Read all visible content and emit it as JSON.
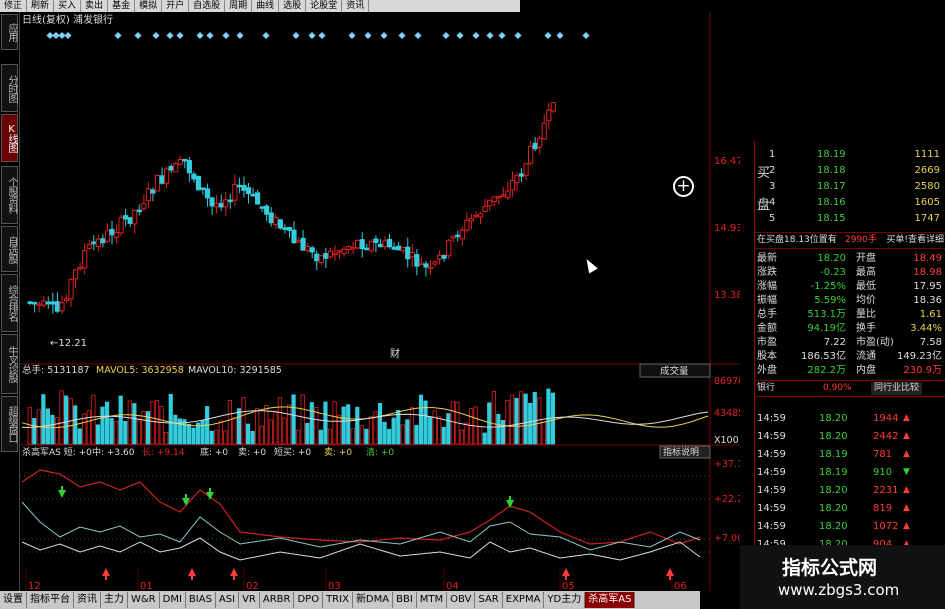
{
  "toolbar": [
    "修正",
    "刷新",
    "买入",
    "卖出",
    "基金",
    "模拟",
    "开户",
    "自选股",
    "周期",
    "曲线",
    "选股",
    "论股堂",
    "资讯"
  ],
  "left_tabs": [
    "应用",
    "分时图",
    "K线图",
    "个股资料",
    "自选股",
    "综合排名",
    "牛叉诊股",
    "超级盘口"
  ],
  "title": "日线(复权) 浦发银行",
  "price_axis": [
    "16.47",
    "14.93",
    "13.38"
  ],
  "low_label": "12.21",
  "marker_label": "财",
  "volume_header": {
    "total": "总手: 5131187",
    "mavol5": "MAVOL5: 3632958",
    "mavol10": "MAVOL10: 3291585",
    "dropdown": "成交量"
  },
  "volume_axis": [
    "86970",
    "43485",
    "X100"
  ],
  "indicator_header": {
    "name": "杀高军AS 短: +0",
    "mid": "中: +3.60",
    "long": "长: +9.14",
    "bottom": "底: +0",
    "sell": "卖: +0",
    "short2": "短买: +0",
    "sell2": "卖: +0",
    "clear": "清: +0",
    "help": "指标说明"
  },
  "indicator_axis": [
    "+37.16",
    "+22.27",
    "+7.00"
  ],
  "time_axis": [
    "12",
    "01",
    "02",
    "03",
    "04",
    "05",
    "06"
  ],
  "bottom_tabs": [
    "设置",
    "指标平台",
    "资讯",
    "主力",
    "W&R",
    "DMI",
    "BIAS",
    "ASI",
    "VR",
    "ARBR",
    "DPO",
    "TRIX",
    "新DMA",
    "BBI",
    "MTM",
    "OBV",
    "SAR",
    "EXPMA",
    "YD主力",
    "杀高军AS"
  ],
  "order_book": [
    {
      "side": "买",
      "level": "1",
      "price": "18.19",
      "vol": "1111"
    },
    {
      "side": "",
      "level": "2",
      "price": "18.18",
      "vol": "2669"
    },
    {
      "side": "",
      "level": "3",
      "price": "18.17",
      "vol": "2580"
    },
    {
      "side": "盘",
      "level": "4",
      "price": "18.16",
      "vol": "1605"
    },
    {
      "side": "",
      "level": "5",
      "price": "18.15",
      "vol": "1747"
    }
  ],
  "order_note": "在买盘18.13位置有",
  "order_note_vol": "2990手",
  "order_note_btn": "买单!查看详细",
  "quote_stats": [
    [
      "最新",
      "18.20",
      "开盘",
      "18.49"
    ],
    [
      "涨跌",
      "-0.23",
      "最高",
      "18.98"
    ],
    [
      "涨幅",
      "-1.25%",
      "最低",
      "17.95"
    ],
    [
      "振幅",
      "5.59%",
      "均价",
      "18.36"
    ],
    [
      "总手",
      "513.1万",
      "量比",
      "1.61"
    ],
    [
      "金额",
      "94.19亿",
      "换手",
      "3.44%"
    ],
    [
      "市盈",
      "7.22",
      "市盈(动)",
      "7.58"
    ],
    [
      "股本",
      "186.53亿",
      "流通",
      "149.23亿"
    ],
    [
      "外盘",
      "282.2万",
      "内盘",
      "230.9万"
    ]
  ],
  "sector": {
    "name": "银行",
    "change": "0.90%",
    "btn": "同行业比较"
  },
  "trades": [
    {
      "time": "14:59",
      "price": "18.20",
      "vol": "1944",
      "dir": "up"
    },
    {
      "time": "14:59",
      "price": "18.20",
      "vol": "2442",
      "dir": "up"
    },
    {
      "time": "14:59",
      "price": "18.19",
      "vol": "781",
      "dir": "up"
    },
    {
      "time": "14:59",
      "price": "18.19",
      "vol": "910",
      "dir": "down"
    },
    {
      "time": "14:59",
      "price": "18.20",
      "vol": "2231",
      "dir": "up"
    },
    {
      "time": "14:59",
      "price": "18.20",
      "vol": "819",
      "dir": "up"
    },
    {
      "time": "14:59",
      "price": "18.20",
      "vol": "1072",
      "dir": "up"
    },
    {
      "time": "14:59",
      "price": "18.20",
      "vol": "904",
      "dir": "up"
    }
  ],
  "watermark": {
    "title": "指标公式网",
    "url": "www.zbgs3.com"
  },
  "colors": {
    "up": "#e02020",
    "down": "#33ccdd",
    "bg": "#000000",
    "grid": "#7a0000"
  }
}
